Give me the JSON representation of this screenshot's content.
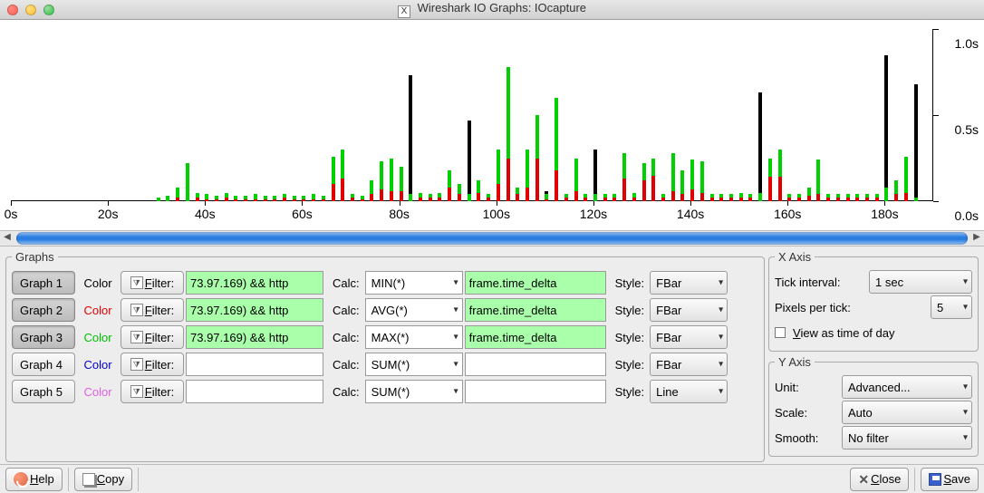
{
  "window": {
    "title": "Wireshark IO Graphs: IOcapture"
  },
  "chart_data": {
    "type": "bar",
    "xlabel": "",
    "ylabel": "",
    "x_ticks": [
      "0s",
      "20s",
      "40s",
      "60s",
      "80s",
      "100s",
      "120s",
      "140s",
      "160s",
      "180s"
    ],
    "y_ticks": [
      "0.0s",
      "0.5s",
      "1.0s"
    ],
    "ylim": [
      0,
      1.0
    ],
    "xlim": [
      0,
      190
    ],
    "series": [
      {
        "name": "MAX(*)",
        "color": "black"
      },
      {
        "name": "AVG(*)",
        "color": "red"
      },
      {
        "name": "MIN(*)",
        "color": "green"
      }
    ],
    "bars": [
      {
        "x": 30,
        "green": 0.02,
        "red": 0,
        "black": 0
      },
      {
        "x": 32,
        "green": 0.03,
        "red": 0,
        "black": 0
      },
      {
        "x": 34,
        "green": 0.08,
        "red": 0.02,
        "black": 0
      },
      {
        "x": 36,
        "green": 0.22,
        "red": 0,
        "black": 0
      },
      {
        "x": 38,
        "green": 0.05,
        "red": 0.02,
        "black": 0
      },
      {
        "x": 40,
        "green": 0.04,
        "red": 0.01,
        "black": 0
      },
      {
        "x": 42,
        "green": 0.03,
        "red": 0.01,
        "black": 0
      },
      {
        "x": 44,
        "green": 0.05,
        "red": 0.02,
        "black": 0
      },
      {
        "x": 46,
        "green": 0.03,
        "red": 0.01,
        "black": 0
      },
      {
        "x": 48,
        "green": 0.03,
        "red": 0.01,
        "black": 0
      },
      {
        "x": 50,
        "green": 0.04,
        "red": 0.01,
        "black": 0
      },
      {
        "x": 52,
        "green": 0.03,
        "red": 0.01,
        "black": 0
      },
      {
        "x": 54,
        "green": 0.03,
        "red": 0.01,
        "black": 0
      },
      {
        "x": 56,
        "green": 0.04,
        "red": 0.02,
        "black": 0
      },
      {
        "x": 58,
        "green": 0.03,
        "red": 0.01,
        "black": 0
      },
      {
        "x": 60,
        "green": 0.03,
        "red": 0.01,
        "black": 0
      },
      {
        "x": 62,
        "green": 0.04,
        "red": 0.01,
        "black": 0
      },
      {
        "x": 64,
        "green": 0.03,
        "red": 0.01,
        "black": 0
      },
      {
        "x": 66,
        "green": 0.26,
        "red": 0.1,
        "black": 0
      },
      {
        "x": 68,
        "green": 0.3,
        "red": 0.13,
        "black": 0
      },
      {
        "x": 70,
        "green": 0.04,
        "red": 0.02,
        "black": 0
      },
      {
        "x": 72,
        "green": 0.03,
        "red": 0.01,
        "black": 0
      },
      {
        "x": 74,
        "green": 0.12,
        "red": 0.04,
        "black": 0
      },
      {
        "x": 76,
        "green": 0.23,
        "red": 0.07,
        "black": 0
      },
      {
        "x": 78,
        "green": 0.25,
        "red": 0.06,
        "black": 0
      },
      {
        "x": 80,
        "green": 0.2,
        "red": 0.06,
        "black": 0
      },
      {
        "x": 82,
        "green": 0.04,
        "red": 0,
        "black": 0.73
      },
      {
        "x": 84,
        "green": 0.05,
        "red": 0.02,
        "black": 0
      },
      {
        "x": 86,
        "green": 0.04,
        "red": 0.02,
        "black": 0
      },
      {
        "x": 88,
        "green": 0.05,
        "red": 0.02,
        "black": 0.02
      },
      {
        "x": 90,
        "green": 0.18,
        "red": 0.08,
        "black": 0
      },
      {
        "x": 92,
        "green": 0.1,
        "red": 0.04,
        "black": 0
      },
      {
        "x": 94,
        "green": 0.04,
        "red": 0,
        "black": 0.47
      },
      {
        "x": 96,
        "green": 0.12,
        "red": 0.05,
        "black": 0
      },
      {
        "x": 98,
        "green": 0.04,
        "red": 0.02,
        "black": 0
      },
      {
        "x": 100,
        "green": 0.3,
        "red": 0.1,
        "black": 0
      },
      {
        "x": 102,
        "green": 0.78,
        "red": 0.25,
        "black": 0
      },
      {
        "x": 104,
        "green": 0.08,
        "red": 0.04,
        "black": 0.04
      },
      {
        "x": 106,
        "green": 0.3,
        "red": 0.08,
        "black": 0.08
      },
      {
        "x": 108,
        "green": 0.5,
        "red": 0.25,
        "black": 0
      },
      {
        "x": 110,
        "green": 0.04,
        "red": 0.01,
        "black": 0.06
      },
      {
        "x": 112,
        "green": 0.6,
        "red": 0.18,
        "black": 0.18
      },
      {
        "x": 114,
        "green": 0.04,
        "red": 0.02,
        "black": 0
      },
      {
        "x": 116,
        "green": 0.25,
        "red": 0.06,
        "black": 0
      },
      {
        "x": 118,
        "green": 0.04,
        "red": 0.02,
        "black": 0
      },
      {
        "x": 120,
        "green": 0.04,
        "red": 0,
        "black": 0.3
      },
      {
        "x": 122,
        "green": 0.04,
        "red": 0.02,
        "black": 0
      },
      {
        "x": 124,
        "green": 0.04,
        "red": 0.02,
        "black": 0
      },
      {
        "x": 126,
        "green": 0.28,
        "red": 0.13,
        "black": 0.04
      },
      {
        "x": 128,
        "green": 0.05,
        "red": 0.02,
        "black": 0
      },
      {
        "x": 130,
        "green": 0.22,
        "red": 0.12,
        "black": 0
      },
      {
        "x": 132,
        "green": 0.25,
        "red": 0.15,
        "black": 0
      },
      {
        "x": 134,
        "green": 0.04,
        "red": 0.02,
        "black": 0
      },
      {
        "x": 136,
        "green": 0.28,
        "red": 0.06,
        "black": 0
      },
      {
        "x": 138,
        "green": 0.18,
        "red": 0.04,
        "black": 0
      },
      {
        "x": 140,
        "green": 0.24,
        "red": 0.07,
        "black": 0
      },
      {
        "x": 142,
        "green": 0.23,
        "red": 0.05,
        "black": 0
      },
      {
        "x": 144,
        "green": 0.04,
        "red": 0.02,
        "black": 0
      },
      {
        "x": 146,
        "green": 0.04,
        "red": 0.02,
        "black": 0
      },
      {
        "x": 148,
        "green": 0.04,
        "red": 0.02,
        "black": 0
      },
      {
        "x": 150,
        "green": 0.05,
        "red": 0.02,
        "black": 0
      },
      {
        "x": 152,
        "green": 0.04,
        "red": 0.02,
        "black": 0
      },
      {
        "x": 154,
        "green": 0.05,
        "red": 0,
        "black": 0.63
      },
      {
        "x": 156,
        "green": 0.25,
        "red": 0.14,
        "black": 0
      },
      {
        "x": 158,
        "green": 0.3,
        "red": 0.14,
        "black": 0
      },
      {
        "x": 160,
        "green": 0.04,
        "red": 0.02,
        "black": 0
      },
      {
        "x": 162,
        "green": 0.04,
        "red": 0.02,
        "black": 0
      },
      {
        "x": 164,
        "green": 0.08,
        "red": 0.03,
        "black": 0
      },
      {
        "x": 166,
        "green": 0.24,
        "red": 0.04,
        "black": 0
      },
      {
        "x": 168,
        "green": 0.04,
        "red": 0.02,
        "black": 0
      },
      {
        "x": 170,
        "green": 0.04,
        "red": 0.02,
        "black": 0
      },
      {
        "x": 172,
        "green": 0.04,
        "red": 0.02,
        "black": 0
      },
      {
        "x": 174,
        "green": 0.04,
        "red": 0.02,
        "black": 0
      },
      {
        "x": 176,
        "green": 0.04,
        "red": 0.02,
        "black": 0
      },
      {
        "x": 178,
        "green": 0.04,
        "red": 0.02,
        "black": 0
      },
      {
        "x": 180,
        "green": 0.08,
        "red": 0,
        "black": 0.85
      },
      {
        "x": 182,
        "green": 0.12,
        "red": 0.04,
        "black": 0.05
      },
      {
        "x": 184,
        "green": 0.26,
        "red": 0.05,
        "black": 0
      },
      {
        "x": 186,
        "green": 0.02,
        "red": 0,
        "black": 0.68
      }
    ]
  },
  "graphs": {
    "legend": "Graphs",
    "color_label": "Color",
    "filter_label": "Filter:",
    "calc_label": "Calc:",
    "style_label": "Style:",
    "rows": [
      {
        "btn": "Graph 1",
        "active": true,
        "color": "#000000",
        "filter": "73.97.169) && http",
        "calc": "MIN(*)",
        "field": "frame.time_delta",
        "field_green": true,
        "style": "FBar"
      },
      {
        "btn": "Graph 2",
        "active": true,
        "color": "#e00000",
        "filter": "73.97.169) && http",
        "calc": "AVG(*)",
        "field": "frame.time_delta",
        "field_green": true,
        "style": "FBar"
      },
      {
        "btn": "Graph 3",
        "active": true,
        "color": "#00c000",
        "filter": "73.97.169) && http",
        "calc": "MAX(*)",
        "field": "frame.time_delta",
        "field_green": true,
        "style": "FBar"
      },
      {
        "btn": "Graph 4",
        "active": false,
        "color": "#0000d0",
        "filter": "",
        "calc": "SUM(*)",
        "field": "",
        "field_green": false,
        "style": "FBar"
      },
      {
        "btn": "Graph 5",
        "active": false,
        "color": "#e060e0",
        "filter": "",
        "calc": "SUM(*)",
        "field": "",
        "field_green": false,
        "style": "Line"
      }
    ]
  },
  "xaxis": {
    "legend": "X Axis",
    "tick_label": "Tick interval:",
    "tick_value": "1 sec",
    "ppt_label": "Pixels per tick:",
    "ppt_value": "5",
    "tod_label": "View as time of day"
  },
  "yaxis": {
    "legend": "Y Axis",
    "unit_label": "Unit:",
    "unit_value": "Advanced...",
    "scale_label": "Scale:",
    "scale_value": "Auto",
    "smooth_label": "Smooth:",
    "smooth_value": "No filter"
  },
  "bottom": {
    "help": "Help",
    "copy": "Copy",
    "close": "Close",
    "save": "Save"
  }
}
